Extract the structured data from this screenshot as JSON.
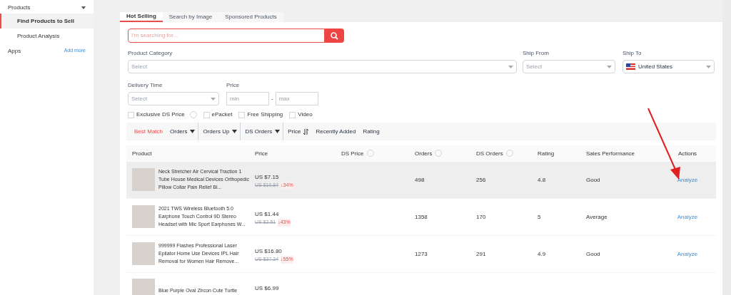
{
  "sidebar": {
    "sections": [
      {
        "label": "Products",
        "expanded": true,
        "children": [
          {
            "label": "Find Products to Sell",
            "selected": true
          },
          {
            "label": "Product Analysis",
            "selected": false
          }
        ]
      }
    ],
    "apps": {
      "label": "Apps",
      "action": "Add more"
    }
  },
  "tabs": [
    {
      "label": "Hot Selling",
      "selected": true
    },
    {
      "label": "Search by Image",
      "selected": false
    },
    {
      "label": "Sponsored Products",
      "selected": false
    }
  ],
  "search": {
    "placeholder": "I'm searching for..."
  },
  "filters": {
    "category": {
      "label": "Product Category",
      "placeholder": "Select"
    },
    "ship_from": {
      "label": "Ship From",
      "placeholder": "Select"
    },
    "ship_to": {
      "label": "Ship To",
      "value": "United States"
    },
    "delivery": {
      "label": "Delivery Time",
      "placeholder": "Select"
    },
    "price": {
      "label": "Price",
      "min_placeholder": "min",
      "separator": "-",
      "max_placeholder": "max"
    }
  },
  "checkboxes": [
    {
      "label": "Exclusive DS Price",
      "checked": false,
      "help": true
    },
    {
      "label": "ePacket",
      "checked": false,
      "help": false
    },
    {
      "label": "Free Shipping",
      "checked": false,
      "help": false
    },
    {
      "label": "Video",
      "checked": false,
      "help": false
    }
  ],
  "sort": [
    {
      "label": "Best Match",
      "selected": true,
      "kind": "plain"
    },
    {
      "label": "Orders",
      "selected": false,
      "kind": "caret"
    },
    {
      "label": "Orders Up",
      "selected": false,
      "kind": "caret"
    },
    {
      "label": "DS Orders",
      "selected": false,
      "kind": "caret"
    },
    {
      "label": "Price",
      "selected": false,
      "kind": "updown"
    },
    {
      "label": "Recently Added",
      "selected": false,
      "kind": "plain"
    },
    {
      "label": "Rating",
      "selected": false,
      "kind": "plain"
    }
  ],
  "table": {
    "columns": [
      {
        "label": "Product",
        "help": false
      },
      {
        "label": "Price",
        "help": false
      },
      {
        "label": "DS Price",
        "help": true
      },
      {
        "label": "Orders",
        "help": true
      },
      {
        "label": "DS Orders",
        "help": true
      },
      {
        "label": "Rating",
        "help": false
      },
      {
        "label": "Sales Performance",
        "help": false
      },
      {
        "label": "Actions",
        "help": false
      }
    ],
    "rows": [
      {
        "title": "Neck Stretcher Air Cervical Traction 1 Tube House Medical Devices Orthopedic Pillow Collar Pain Relief Bl...",
        "price": "US $7.15",
        "old_price": "US $10.84",
        "discount": "↓34%",
        "orders": "498",
        "ds_orders": "256",
        "rating": "4.8",
        "performance": "Good",
        "action": "Analyze",
        "selected": true
      },
      {
        "title": "2021 TWS Wireless Bluetooth 5.0 Earphone Touch Control 9D Stereo Headset with Mic Sport Earphones W...",
        "price": "US $1.44",
        "old_price": "US $2.51",
        "discount": "↓43%",
        "orders": "1358",
        "ds_orders": "170",
        "rating": "5",
        "performance": "Average",
        "action": "Analyze",
        "selected": false
      },
      {
        "title": "999999 Flashes Professional Laser Epilator Home Use Devices IPL Hair Removal for Women Hair Remove...",
        "price": "US $16.80",
        "old_price": "US $37.34",
        "discount": "↓55%",
        "orders": "1273",
        "ds_orders": "291",
        "rating": "4.9",
        "performance": "Good",
        "action": "Analyze",
        "selected": false
      },
      {
        "title": "Blue Purple Oval Zircon Cute Turtle",
        "price": "US $6.99",
        "selected": false
      }
    ]
  }
}
